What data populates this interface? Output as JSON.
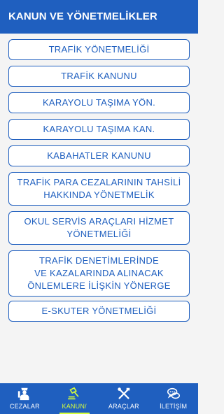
{
  "header": {
    "title": "KANUN VE YÖNETMELİKLER"
  },
  "items": [
    {
      "label": "TRAFİK YÖNETMELİĞİ"
    },
    {
      "label": "TRAFİK KANUNU"
    },
    {
      "label": "KARAYOLU TAŞIMA YÖN."
    },
    {
      "label": "KARAYOLU TAŞIMA KAN."
    },
    {
      "label": "KABAHATLER KANUNU"
    },
    {
      "label": "TRAFİK PARA CEZALARININ TAHSİLİ\nHAKKINDA YÖNETMELİK"
    },
    {
      "label": "OKUL SERVİS ARAÇLARI HİZMET\nYÖNETMELİĞİ"
    },
    {
      "label": "TRAFİK DENETİMLERİNDE\nVE KAZALARINDA ALINACAK\nÖNLEMLERE İLİŞKİN YÖNERGE"
    },
    {
      "label": "E-SKUTER YÖNETMELİĞİ"
    }
  ],
  "nav": [
    {
      "label": "CEZALAR",
      "icon": "police-officer-icon",
      "active": false
    },
    {
      "label": "KANUN/",
      "icon": "gavel-icon",
      "active": true
    },
    {
      "label": "ARAÇLAR",
      "icon": "tools-icon",
      "active": false
    },
    {
      "label": "İLETİŞİM",
      "icon": "chat-bubbles-icon",
      "active": false
    }
  ],
  "colors": {
    "primary": "#1f5fbf",
    "active_accent": "#d6ff3a",
    "background": "#f4f4f4"
  }
}
